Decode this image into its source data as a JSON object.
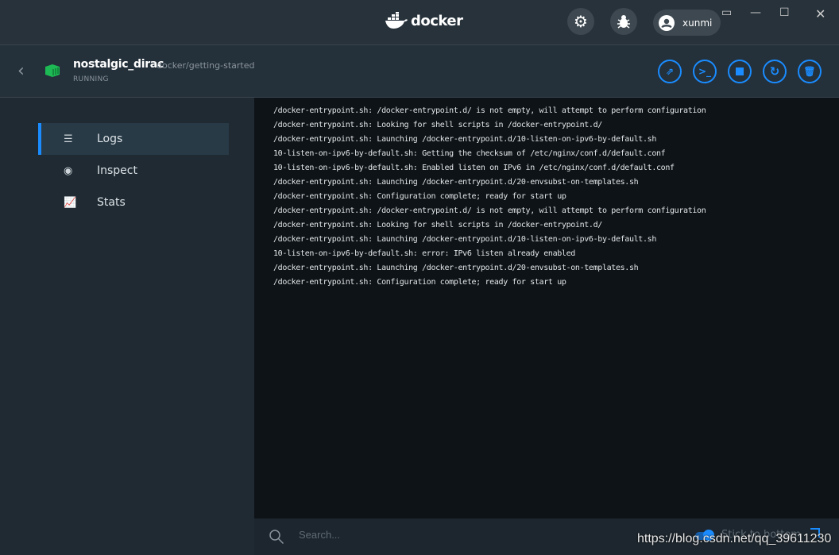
{
  "titlebar": {
    "brand": "docker",
    "user": "xunmi",
    "icons": [
      "settings-gear-icon",
      "bug-icon",
      "user-avatar-icon"
    ]
  },
  "container": {
    "name": "nostalgic_dirac",
    "image": "docker/getting-started",
    "status": "RUNNING",
    "status_color": "#1db954"
  },
  "actions": [
    "open-in-browser",
    "cli",
    "stop",
    "restart",
    "delete"
  ],
  "sidebar": {
    "items": [
      {
        "label": "Logs",
        "active": true
      },
      {
        "label": "Inspect"
      },
      {
        "label": "Stats"
      }
    ]
  },
  "logs": [
    "/docker-entrypoint.sh: /docker-entrypoint.d/ is not empty, will attempt to perform configuration",
    "/docker-entrypoint.sh: Looking for shell scripts in /docker-entrypoint.d/",
    "/docker-entrypoint.sh: Launching /docker-entrypoint.d/10-listen-on-ipv6-by-default.sh",
    "10-listen-on-ipv6-by-default.sh: Getting the checksum of /etc/nginx/conf.d/default.conf",
    "10-listen-on-ipv6-by-default.sh: Enabled listen on IPv6 in /etc/nginx/conf.d/default.conf",
    "/docker-entrypoint.sh: Launching /docker-entrypoint.d/20-envsubst-on-templates.sh",
    "/docker-entrypoint.sh: Configuration complete; ready for start up",
    "/docker-entrypoint.sh: /docker-entrypoint.d/ is not empty, will attempt to perform configuration",
    "/docker-entrypoint.sh: Looking for shell scripts in /docker-entrypoint.d/",
    "/docker-entrypoint.sh: Launching /docker-entrypoint.d/10-listen-on-ipv6-by-default.sh",
    "10-listen-on-ipv6-by-default.sh: error: IPv6 listen already enabled",
    "/docker-entrypoint.sh: Launching /docker-entrypoint.d/20-envsubst-on-templates.sh",
    "/docker-entrypoint.sh: Configuration complete; ready for start up"
  ],
  "footer": {
    "search_placeholder": "Search...",
    "stick_label": "Stick to bottom",
    "stick_enabled": true
  },
  "watermark": "https://blog.csdn.net/qq_39611230",
  "accent": "#1a8cff"
}
